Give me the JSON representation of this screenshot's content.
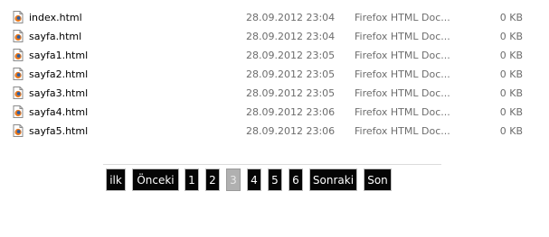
{
  "files": [
    {
      "name": "index.html",
      "date": "28.09.2012 23:04",
      "type": "Firefox HTML Doc...",
      "size": "0 KB"
    },
    {
      "name": "sayfa.html",
      "date": "28.09.2012 23:04",
      "type": "Firefox HTML Doc...",
      "size": "0 KB"
    },
    {
      "name": "sayfa1.html",
      "date": "28.09.2012 23:05",
      "type": "Firefox HTML Doc...",
      "size": "0 KB"
    },
    {
      "name": "sayfa2.html",
      "date": "28.09.2012 23:05",
      "type": "Firefox HTML Doc...",
      "size": "0 KB"
    },
    {
      "name": "sayfa3.html",
      "date": "28.09.2012 23:05",
      "type": "Firefox HTML Doc...",
      "size": "0 KB"
    },
    {
      "name": "sayfa4.html",
      "date": "28.09.2012 23:06",
      "type": "Firefox HTML Doc...",
      "size": "0 KB"
    },
    {
      "name": "sayfa5.html",
      "date": "28.09.2012 23:06",
      "type": "Firefox HTML Doc...",
      "size": "0 KB"
    }
  ],
  "file_icon": "firefox-html-document-icon",
  "pagination": {
    "first": "ilk",
    "prev": "Önceki",
    "pages": [
      "1",
      "2",
      "3",
      "4",
      "5",
      "6"
    ],
    "current": "3",
    "next": "Sonraki",
    "last": "Son"
  },
  "colors": {
    "button_bg": "#050505",
    "button_text": "#ffffff",
    "active_bg": "#b0b0b0",
    "meta_text": "#6d6d6d"
  }
}
